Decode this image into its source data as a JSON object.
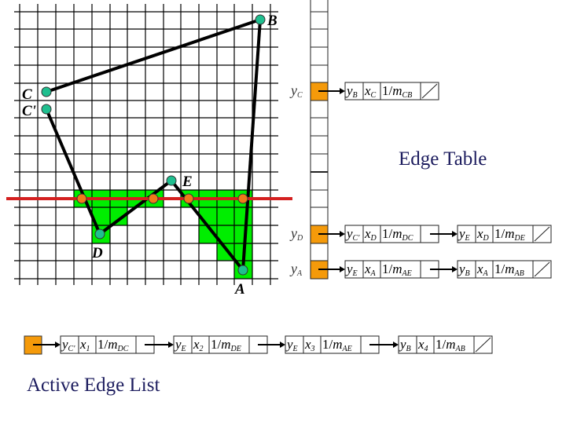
{
  "colors": {
    "grid": "#000000",
    "fill": "#00ee00",
    "edge": "#000000",
    "vertex": "#1fbf8f",
    "intersection": "#f07a1a",
    "scanline": "#d42020",
    "bucket_active": "#f59a0a",
    "title": "#1c1c5e"
  },
  "vertices": {
    "B": "B",
    "C": "C",
    "C_prime": "C'",
    "D": "D",
    "E": "E",
    "A": "A"
  },
  "edge_table": {
    "title": "Edge Table",
    "buckets": [
      {
        "label": {
          "v": "y",
          "s": "C"
        },
        "nodes": [
          [
            {
              "v": "y",
              "s": "B"
            },
            {
              "v": "x",
              "s": "C"
            },
            {
              "n": "1/",
              "v": "m",
              "s": "CB"
            }
          ]
        ]
      },
      {
        "label": {
          "v": "y",
          "s": "D"
        },
        "nodes": [
          [
            {
              "v": "y",
              "s": "C'"
            },
            {
              "v": "x",
              "s": "D"
            },
            {
              "n": "1/",
              "v": "m",
              "s": "DC"
            }
          ],
          [
            {
              "v": "y",
              "s": "E"
            },
            {
              "v": "x",
              "s": "D"
            },
            {
              "n": "1/",
              "v": "m",
              "s": "DE"
            }
          ]
        ]
      },
      {
        "label": {
          "v": "y",
          "s": "A"
        },
        "nodes": [
          [
            {
              "v": "y",
              "s": "E"
            },
            {
              "v": "x",
              "s": "A"
            },
            {
              "n": "1/",
              "v": "m",
              "s": "AE"
            }
          ],
          [
            {
              "v": "y",
              "s": "B"
            },
            {
              "v": "x",
              "s": "A"
            },
            {
              "n": "1/",
              "v": "m",
              "s": "AB"
            }
          ]
        ]
      }
    ]
  },
  "active_edge_list": {
    "title": "Active Edge List",
    "nodes": [
      [
        {
          "v": "y",
          "s": "C'"
        },
        {
          "v": "x",
          "s": "1"
        },
        {
          "n": "1/",
          "v": "m",
          "s": "DC"
        }
      ],
      [
        {
          "v": "y",
          "s": "E"
        },
        {
          "v": "x",
          "s": "2"
        },
        {
          "n": "1/",
          "v": "m",
          "s": "DE"
        }
      ],
      [
        {
          "v": "y",
          "s": "E"
        },
        {
          "v": "x",
          "s": "3"
        },
        {
          "n": "1/",
          "v": "m",
          "s": "AE"
        }
      ],
      [
        {
          "v": "y",
          "s": "B"
        },
        {
          "v": "x",
          "s": "4"
        },
        {
          "n": "1/",
          "v": "m",
          "s": "AB"
        }
      ]
    ]
  }
}
